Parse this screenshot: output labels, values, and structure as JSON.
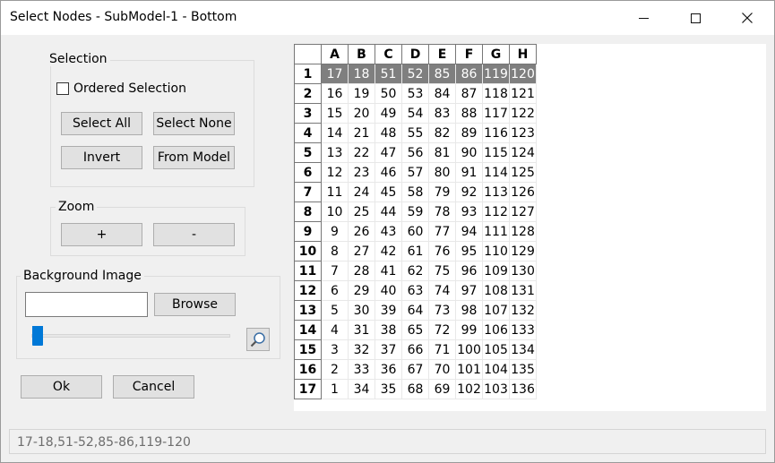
{
  "window": {
    "title": "Select Nodes - SubModel-1 - Bottom",
    "minimize_glyph": "—",
    "maximize_glyph": "☐",
    "close_glyph": "✕"
  },
  "selection": {
    "label": "Selection",
    "ordered_label": "Ordered Selection",
    "ordered_checked": false,
    "select_all": "Select All",
    "select_none": "Select None",
    "invert": "Invert",
    "from_model": "From Model"
  },
  "zoom": {
    "label": "Zoom",
    "plus": "+",
    "minus": "-"
  },
  "background": {
    "label": "Background Image",
    "path_value": "",
    "browse": "Browse",
    "slider_level": 0
  },
  "actions": {
    "ok": "Ok",
    "cancel": "Cancel"
  },
  "grid": {
    "columns": [
      "A",
      "B",
      "C",
      "D",
      "E",
      "F",
      "G",
      "H"
    ],
    "rows": [
      {
        "label": "1",
        "cells": [
          "17",
          "18",
          "51",
          "52",
          "85",
          "86",
          "119",
          "120"
        ],
        "selected": [
          true,
          true,
          true,
          true,
          true,
          true,
          true,
          true
        ]
      },
      {
        "label": "2",
        "cells": [
          "16",
          "19",
          "50",
          "53",
          "84",
          "87",
          "118",
          "121"
        ]
      },
      {
        "label": "3",
        "cells": [
          "15",
          "20",
          "49",
          "54",
          "83",
          "88",
          "117",
          "122"
        ]
      },
      {
        "label": "4",
        "cells": [
          "14",
          "21",
          "48",
          "55",
          "82",
          "89",
          "116",
          "123"
        ]
      },
      {
        "label": "5",
        "cells": [
          "13",
          "22",
          "47",
          "56",
          "81",
          "90",
          "115",
          "124"
        ]
      },
      {
        "label": "6",
        "cells": [
          "12",
          "23",
          "46",
          "57",
          "80",
          "91",
          "114",
          "125"
        ]
      },
      {
        "label": "7",
        "cells": [
          "11",
          "24",
          "45",
          "58",
          "79",
          "92",
          "113",
          "126"
        ]
      },
      {
        "label": "8",
        "cells": [
          "10",
          "25",
          "44",
          "59",
          "78",
          "93",
          "112",
          "127"
        ]
      },
      {
        "label": "9",
        "cells": [
          "9",
          "26",
          "43",
          "60",
          "77",
          "94",
          "111",
          "128"
        ]
      },
      {
        "label": "10",
        "cells": [
          "8",
          "27",
          "42",
          "61",
          "76",
          "95",
          "110",
          "129"
        ]
      },
      {
        "label": "11",
        "cells": [
          "7",
          "28",
          "41",
          "62",
          "75",
          "96",
          "109",
          "130"
        ]
      },
      {
        "label": "12",
        "cells": [
          "6",
          "29",
          "40",
          "63",
          "74",
          "97",
          "108",
          "131"
        ]
      },
      {
        "label": "13",
        "cells": [
          "5",
          "30",
          "39",
          "64",
          "73",
          "98",
          "107",
          "132"
        ]
      },
      {
        "label": "14",
        "cells": [
          "4",
          "31",
          "38",
          "65",
          "72",
          "99",
          "106",
          "133"
        ]
      },
      {
        "label": "15",
        "cells": [
          "3",
          "32",
          "37",
          "66",
          "71",
          "100",
          "105",
          "134"
        ]
      },
      {
        "label": "16",
        "cells": [
          "2",
          "33",
          "36",
          "67",
          "70",
          "101",
          "104",
          "135"
        ]
      },
      {
        "label": "17",
        "cells": [
          "1",
          "34",
          "35",
          "68",
          "69",
          "102",
          "103",
          "136"
        ]
      }
    ]
  },
  "status": {
    "text": "17-18,51-52,85-86,119-120"
  },
  "colors": {
    "selected_cell": "#7f7f7f",
    "slider_accent": "#0078d7"
  }
}
